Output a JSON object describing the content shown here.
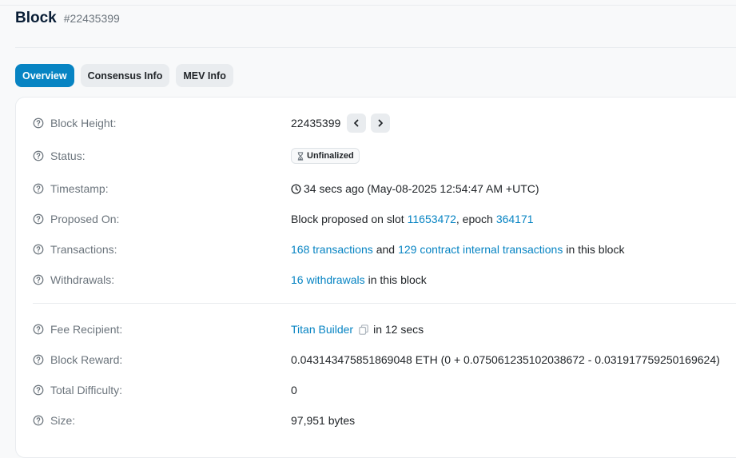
{
  "header": {
    "title": "Block",
    "block_id": "#22435399"
  },
  "tabs": [
    "Overview",
    "Consensus Info",
    "MEV Info"
  ],
  "rows": {
    "block_height": {
      "label": "Block Height:",
      "value": "22435399"
    },
    "status": {
      "label": "Status:",
      "value": "Unfinalized"
    },
    "timestamp": {
      "label": "Timestamp:",
      "value": "34 secs ago (May-08-2025 12:54:47 AM +UTC)"
    },
    "proposed_on": {
      "label": "Proposed On:",
      "prefix": "Block proposed on slot",
      "slot": "11653472",
      "mid": ", epoch",
      "epoch": "364171"
    },
    "transactions": {
      "label": "Transactions:",
      "tx_link": "168 transactions",
      "and": "and",
      "internal_link": "129 contract internal transactions",
      "suffix": "in this block"
    },
    "withdrawals": {
      "label": "Withdrawals:",
      "link": "16 withdrawals",
      "suffix": "in this block"
    },
    "fee_recipient": {
      "label": "Fee Recipient:",
      "link": "Titan Builder",
      "suffix": "in 12 secs"
    },
    "block_reward": {
      "label": "Block Reward:",
      "value": "0.043143475851869048 ETH (0 + 0.075061235102038672 - 0.031917759250169624)"
    },
    "total_difficulty": {
      "label": "Total Difficulty:",
      "value": "0"
    },
    "size": {
      "label": "Size:",
      "value": "97,951 bytes"
    }
  },
  "icons": [
    "help-circle-icon",
    "chevron-left-icon",
    "chevron-right-icon",
    "hourglass-icon",
    "clock-icon",
    "copy-icon"
  ],
  "colors": {
    "accent": "#0784c3",
    "muted": "#6c757d",
    "text": "#212529"
  }
}
